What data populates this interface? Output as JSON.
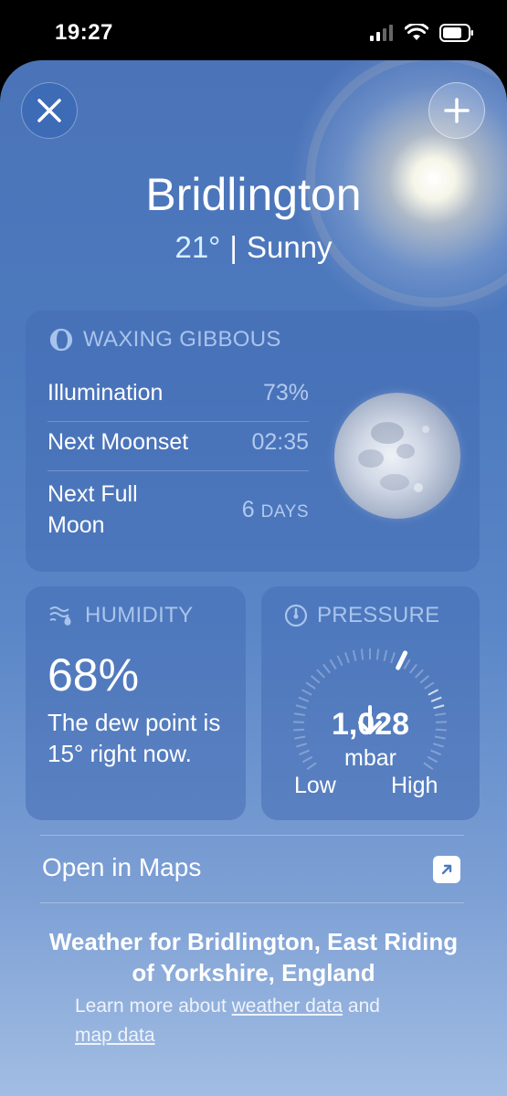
{
  "status_bar": {
    "time": "19:27"
  },
  "header": {
    "city": "Bridlington",
    "temperature": "21°",
    "separator": "|",
    "condition": "Sunny"
  },
  "moon_card": {
    "phase": "WAXING GIBBOUS",
    "rows": [
      {
        "label": "Illumination",
        "value": "73%"
      },
      {
        "label": "Next Moonset",
        "value": "02:35"
      },
      {
        "label": "Next Full Moon",
        "value": "6",
        "unit": "DAYS"
      }
    ]
  },
  "humidity_card": {
    "title": "HUMIDITY",
    "value": "68%",
    "description": "The dew point is 15° right now."
  },
  "pressure_card": {
    "title": "PRESSURE",
    "value": "1,028",
    "unit": "mbar",
    "low_label": "Low",
    "high_label": "High",
    "trend": "falling"
  },
  "maps": {
    "label": "Open in Maps"
  },
  "footer": {
    "title": "Weather for Bridlington, East Riding of Yorkshire, England",
    "learn_more_prefix": "Learn more about",
    "weather_data_link": "weather data",
    "and": "and",
    "map_data_link": "map data"
  },
  "colors": {
    "accent_label": "#a9c4ec",
    "card_bg": "#4a73b8"
  }
}
